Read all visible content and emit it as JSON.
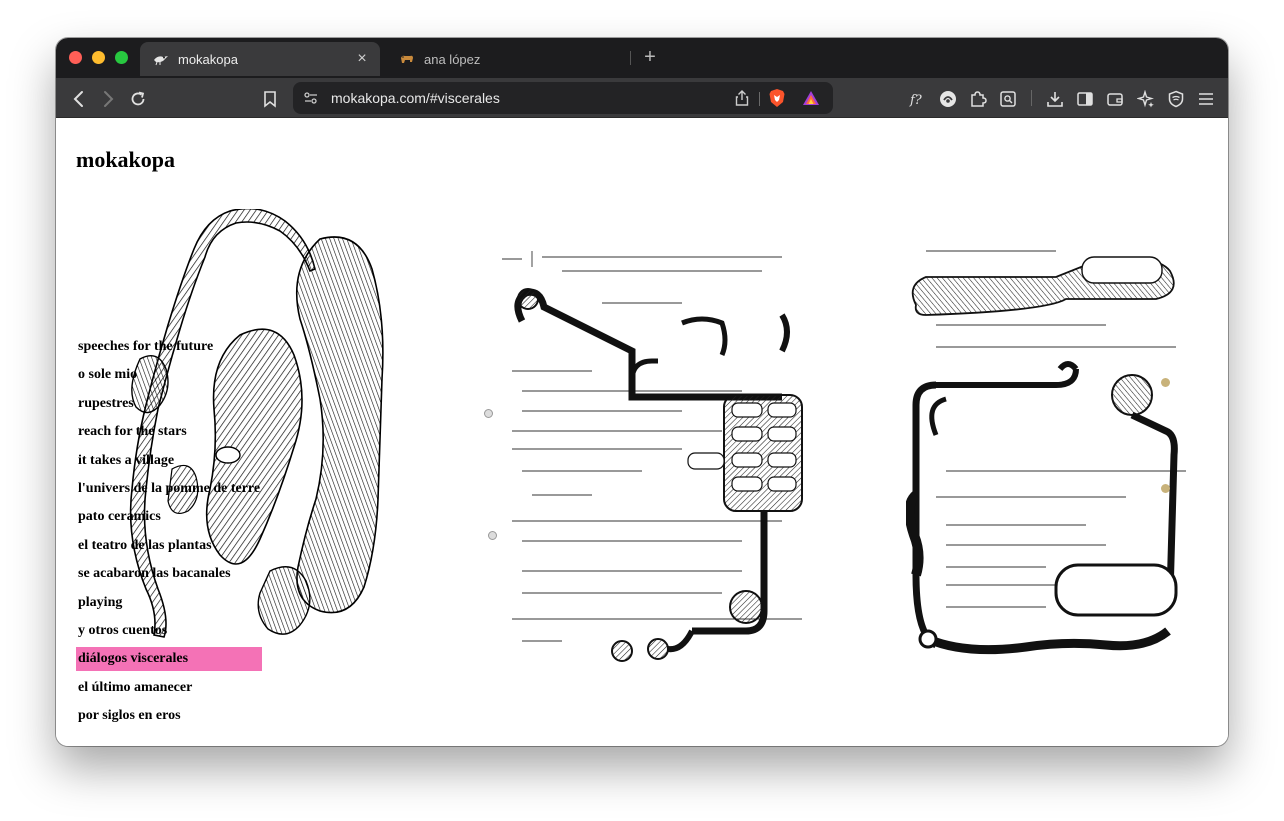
{
  "browser": {
    "tabs": [
      {
        "title": "mokakopa",
        "active": true,
        "favicon": "bird-icon"
      },
      {
        "title": "ana lópez",
        "active": false,
        "favicon": "dog-icon"
      }
    ],
    "new_tab_label": "+",
    "close_label": "×",
    "url": "mokakopa.com/#viscerales",
    "colors": {
      "tabstrip": "#1c1c1e",
      "toolbar": "#3a3a3c",
      "urlbar": "#232325"
    }
  },
  "site": {
    "title": "mokakopa"
  },
  "menu": {
    "items": [
      {
        "label": "speeches for the future"
      },
      {
        "label": "o sole mio"
      },
      {
        "label": "rupestres"
      },
      {
        "label": "reach for the stars"
      },
      {
        "label": "it takes a village"
      },
      {
        "label": "l'univers de la pomme de terre"
      },
      {
        "label": "pato ceramics"
      },
      {
        "label": "el teatro de las plantas"
      },
      {
        "label": "se acabaron las bacanales"
      },
      {
        "label": "playing"
      },
      {
        "label": "y otros cuentos"
      },
      {
        "label": "diálogos viscerales",
        "active": true
      },
      {
        "label": "el último amanecer"
      },
      {
        "label": "por siglos en eros"
      }
    ],
    "active_color": "#f472b6"
  },
  "artworks": [
    {
      "name": "visceral-sculpture-drawing"
    },
    {
      "name": "math-notes-drawing-1"
    },
    {
      "name": "math-notes-drawing-2"
    }
  ]
}
